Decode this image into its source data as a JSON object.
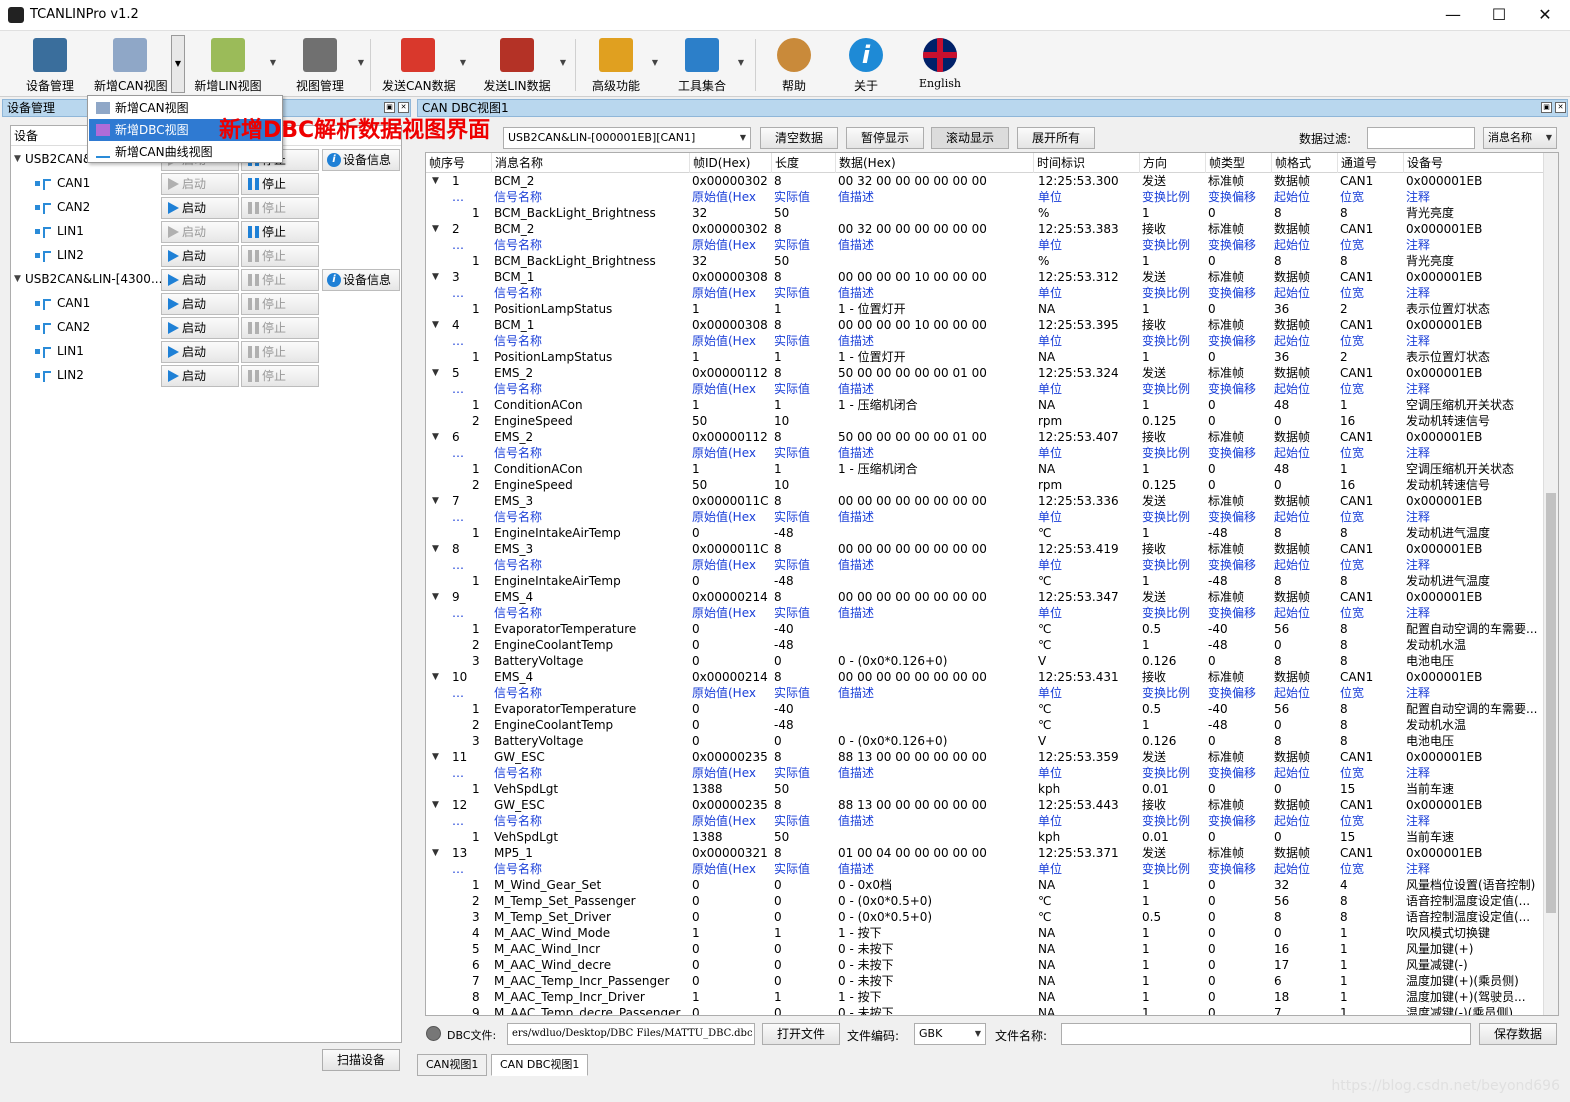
{
  "window": {
    "title": "TCANLINPro v1.2",
    "min": "—",
    "max": "☐",
    "close": "✕"
  },
  "toolbar": [
    {
      "label": "设备管理",
      "icon": "device-manager-icon",
      "color": "#3a6e9c"
    },
    {
      "label": "新增CAN视图",
      "icon": "new-can-view-icon",
      "color": "#8fa7c7"
    },
    {
      "label": "新增LIN视图",
      "icon": "new-lin-view-icon",
      "color": "#9bbb59"
    },
    {
      "label": "视图管理",
      "icon": "view-manager-icon",
      "color": "#707070"
    },
    {
      "label": "发送CAN数据",
      "icon": "send-can-icon",
      "color": "#d9382c"
    },
    {
      "label": "发送LIN数据",
      "icon": "send-lin-icon",
      "color": "#b43226"
    },
    {
      "label": "高级功能",
      "icon": "advanced-icon",
      "color": "#e0a020"
    },
    {
      "label": "工具集合",
      "icon": "tools-icon",
      "color": "#2c7fc9"
    },
    {
      "label": "帮助",
      "icon": "help-icon",
      "color": "#c98a3a"
    },
    {
      "label": "关于",
      "icon": "about-icon",
      "color": "#1e8ad6"
    },
    {
      "label": "English",
      "icon": "english-flag-icon",
      "color": "#c8102e"
    }
  ],
  "dropdown": {
    "items": [
      "新增CAN视图",
      "新增DBC视图",
      "新增CAN曲线视图"
    ],
    "selected": "新增DBC视图"
  },
  "callout": "新增DBC解析数据视图界面",
  "left": {
    "header": "设备管理",
    "col_header": "设备",
    "dev1": "USB2CAN&...",
    "dev2": "USB2CAN&LIN-[4300...",
    "info": "设备信息",
    "start": "启动",
    "stop": "停止",
    "ch": [
      "CAN1",
      "CAN2",
      "LIN1",
      "LIN2"
    ],
    "scan": "扫描设备"
  },
  "right": {
    "header": "CAN DBC视图1",
    "device_select": "USB2CAN&LIN-[000001EB][CAN1]",
    "btn_clear": "清空数据",
    "btn_pause": "暂停显示",
    "btn_scroll": "滚动显示",
    "btn_expand": "展开所有",
    "filter_label": "数据过滤:",
    "filter_value": "",
    "filter_field": "消息名称"
  },
  "grid": {
    "headers": [
      "帧序号",
      "消息名称",
      "帧ID(Hex)",
      "长度",
      "数据(Hex)",
      "时间标识",
      "方向",
      "帧类型",
      "帧格式",
      "通道号",
      "设备号"
    ],
    "sub": [
      "信号名称",
      "原始值(Hex)",
      "实际值",
      "值描述",
      "单位",
      "变换比例",
      "变换偏移",
      "起始位",
      "位宽",
      "注释"
    ],
    "frames": [
      {
        "seq": "1",
        "name": "BCM_2",
        "id": "0x00000302",
        "len": "8",
        "data": "00 32 00 00 00 00 00 00",
        "time": "12:25:53.300",
        "dir": "发送",
        "sigs": [
          [
            "1",
            "BCM_BackLight_Brightness",
            "32",
            "50",
            "",
            "%",
            "1",
            "0",
            "8",
            "8",
            "背光亮度"
          ]
        ]
      },
      {
        "seq": "2",
        "name": "BCM_2",
        "id": "0x00000302",
        "len": "8",
        "data": "00 32 00 00 00 00 00 00",
        "time": "12:25:53.383",
        "dir": "接收",
        "sigs": [
          [
            "1",
            "BCM_BackLight_Brightness",
            "32",
            "50",
            "",
            "%",
            "1",
            "0",
            "8",
            "8",
            "背光亮度"
          ]
        ]
      },
      {
        "seq": "3",
        "name": "BCM_1",
        "id": "0x00000308",
        "len": "8",
        "data": "00 00 00 00 10 00 00 00",
        "time": "12:25:53.312",
        "dir": "发送",
        "sigs": [
          [
            "1",
            "PositionLampStatus",
            "1",
            "1",
            "1 - 位置灯开",
            "NA",
            "1",
            "0",
            "36",
            "2",
            "表示位置灯状态"
          ]
        ]
      },
      {
        "seq": "4",
        "name": "BCM_1",
        "id": "0x00000308",
        "len": "8",
        "data": "00 00 00 00 10 00 00 00",
        "time": "12:25:53.395",
        "dir": "接收",
        "sigs": [
          [
            "1",
            "PositionLampStatus",
            "1",
            "1",
            "1 - 位置灯开",
            "NA",
            "1",
            "0",
            "36",
            "2",
            "表示位置灯状态"
          ]
        ]
      },
      {
        "seq": "5",
        "name": "EMS_2",
        "id": "0x00000112",
        "len": "8",
        "data": "50 00 00 00 00 00 01 00",
        "time": "12:25:53.324",
        "dir": "发送",
        "sigs": [
          [
            "1",
            "ConditionACon",
            "1",
            "1",
            "1 - 压缩机闭合",
            "NA",
            "1",
            "0",
            "48",
            "1",
            "空调压缩机开关状态"
          ],
          [
            "2",
            "EngineSpeed",
            "50",
            "10",
            "",
            "rpm",
            "0.125",
            "0",
            "0",
            "16",
            "发动机转速信号"
          ]
        ]
      },
      {
        "seq": "6",
        "name": "EMS_2",
        "id": "0x00000112",
        "len": "8",
        "data": "50 00 00 00 00 00 01 00",
        "time": "12:25:53.407",
        "dir": "接收",
        "sigs": [
          [
            "1",
            "ConditionACon",
            "1",
            "1",
            "1 - 压缩机闭合",
            "NA",
            "1",
            "0",
            "48",
            "1",
            "空调压缩机开关状态"
          ],
          [
            "2",
            "EngineSpeed",
            "50",
            "10",
            "",
            "rpm",
            "0.125",
            "0",
            "0",
            "16",
            "发动机转速信号"
          ]
        ]
      },
      {
        "seq": "7",
        "name": "EMS_3",
        "id": "0x0000011C",
        "len": "8",
        "data": "00 00 00 00 00 00 00 00",
        "time": "12:25:53.336",
        "dir": "发送",
        "sigs": [
          [
            "1",
            "EngineIntakeAirTemp",
            "0",
            "-48",
            "",
            "℃",
            "1",
            "-48",
            "8",
            "8",
            "发动机进气温度"
          ]
        ]
      },
      {
        "seq": "8",
        "name": "EMS_3",
        "id": "0x0000011C",
        "len": "8",
        "data": "00 00 00 00 00 00 00 00",
        "time": "12:25:53.419",
        "dir": "接收",
        "sigs": [
          [
            "1",
            "EngineIntakeAirTemp",
            "0",
            "-48",
            "",
            "℃",
            "1",
            "-48",
            "8",
            "8",
            "发动机进气温度"
          ]
        ]
      },
      {
        "seq": "9",
        "name": "EMS_4",
        "id": "0x00000214",
        "len": "8",
        "data": "00 00 00 00 00 00 00 00",
        "time": "12:25:53.347",
        "dir": "发送",
        "sigs": [
          [
            "1",
            "EvaporatorTemperature",
            "0",
            "-40",
            "",
            "℃",
            "0.5",
            "-40",
            "56",
            "8",
            "配置自动空调的车需要..."
          ],
          [
            "2",
            "EngineCoolantTemp",
            "0",
            "-48",
            "",
            "℃",
            "1",
            "-48",
            "0",
            "8",
            "发动机水温"
          ],
          [
            "3",
            "BatteryVoltage",
            "0",
            "0",
            "0 - (0x0*0.126+0)",
            "V",
            "0.126",
            "0",
            "8",
            "8",
            "电池电压"
          ]
        ]
      },
      {
        "seq": "10",
        "name": "EMS_4",
        "id": "0x00000214",
        "len": "8",
        "data": "00 00 00 00 00 00 00 00",
        "time": "12:25:53.431",
        "dir": "接收",
        "sigs": [
          [
            "1",
            "EvaporatorTemperature",
            "0",
            "-40",
            "",
            "℃",
            "0.5",
            "-40",
            "56",
            "8",
            "配置自动空调的车需要..."
          ],
          [
            "2",
            "EngineCoolantTemp",
            "0",
            "-48",
            "",
            "℃",
            "1",
            "-48",
            "0",
            "8",
            "发动机水温"
          ],
          [
            "3",
            "BatteryVoltage",
            "0",
            "0",
            "0 - (0x0*0.126+0)",
            "V",
            "0.126",
            "0",
            "8",
            "8",
            "电池电压"
          ]
        ]
      },
      {
        "seq": "11",
        "name": "GW_ESC",
        "id": "0x00000235",
        "len": "8",
        "data": "88 13 00 00 00 00 00 00",
        "time": "12:25:53.359",
        "dir": "发送",
        "sigs": [
          [
            "1",
            "VehSpdLgt",
            "1388",
            "50",
            "",
            "kph",
            "0.01",
            "0",
            "0",
            "15",
            "当前车速"
          ]
        ]
      },
      {
        "seq": "12",
        "name": "GW_ESC",
        "id": "0x00000235",
        "len": "8",
        "data": "88 13 00 00 00 00 00 00",
        "time": "12:25:53.443",
        "dir": "接收",
        "sigs": [
          [
            "1",
            "VehSpdLgt",
            "1388",
            "50",
            "",
            "kph",
            "0.01",
            "0",
            "0",
            "15",
            "当前车速"
          ]
        ]
      },
      {
        "seq": "13",
        "name": "MP5_1",
        "id": "0x00000321",
        "len": "8",
        "data": "01 00 04 00 00 00 00 00",
        "time": "12:25:53.371",
        "dir": "发送",
        "sigs": [
          [
            "1",
            "M_Wind_Gear_Set",
            "0",
            "0",
            "0 - 0x0档",
            "NA",
            "1",
            "0",
            "32",
            "4",
            "风量档位设置(语音控制)"
          ],
          [
            "2",
            "M_Temp_Set_Passenger",
            "0",
            "0",
            "0 - (0x0*0.5+0)",
            "℃",
            "1",
            "0",
            "56",
            "8",
            "语音控制温度设定值(..."
          ],
          [
            "3",
            "M_Temp_Set_Driver",
            "0",
            "0",
            "0 - (0x0*0.5+0)",
            "℃",
            "0.5",
            "0",
            "8",
            "8",
            "语音控制温度设定值(..."
          ],
          [
            "4",
            "M_AAC_Wind_Mode",
            "1",
            "1",
            "1 - 按下",
            "NA",
            "1",
            "0",
            "0",
            "1",
            "吹风模式切换键"
          ],
          [
            "5",
            "M_AAC_Wind_Incr",
            "0",
            "0",
            "0 - 未按下",
            "NA",
            "1",
            "0",
            "16",
            "1",
            "风量加键(+)"
          ],
          [
            "6",
            "M_AAC_Wind_decre",
            "0",
            "0",
            "0 - 未按下",
            "NA",
            "1",
            "0",
            "17",
            "1",
            "风量减键(-)"
          ],
          [
            "7",
            "M_AAC_Temp_Incr_Passenger",
            "0",
            "0",
            "0 - 未按下",
            "NA",
            "1",
            "0",
            "6",
            "1",
            "温度加键(+)(乘员侧)"
          ],
          [
            "8",
            "M_AAC_Temp_Incr_Driver",
            "1",
            "1",
            "1 - 按下",
            "NA",
            "1",
            "0",
            "18",
            "1",
            "温度加键(+)(驾驶员..."
          ],
          [
            "9",
            "M_AAC_Temp_decre_Passenger",
            "0",
            "0",
            "0 - 未按下",
            "NA",
            "1",
            "0",
            "7",
            "1",
            "温度减键(-)(乘员侧)"
          ]
        ]
      }
    ],
    "frame_type": "标准帧",
    "frame_fmt": "数据帧",
    "channel": "CAN1",
    "device": "0x000001EB"
  },
  "bottom": {
    "dbc_label": "DBC文件:",
    "dbc_path": "ers/wdluo/Desktop/DBC Files/MATTU_DBC.dbc",
    "open": "打开文件",
    "enc_label": "文件编码:",
    "enc": "GBK",
    "fname_label": "文件名称:",
    "fname": "",
    "save": "保存数据"
  },
  "tabs": [
    "CAN视图1",
    "CAN DBC视图1"
  ],
  "watermark": "https://blog.csdn.net/beyond696"
}
